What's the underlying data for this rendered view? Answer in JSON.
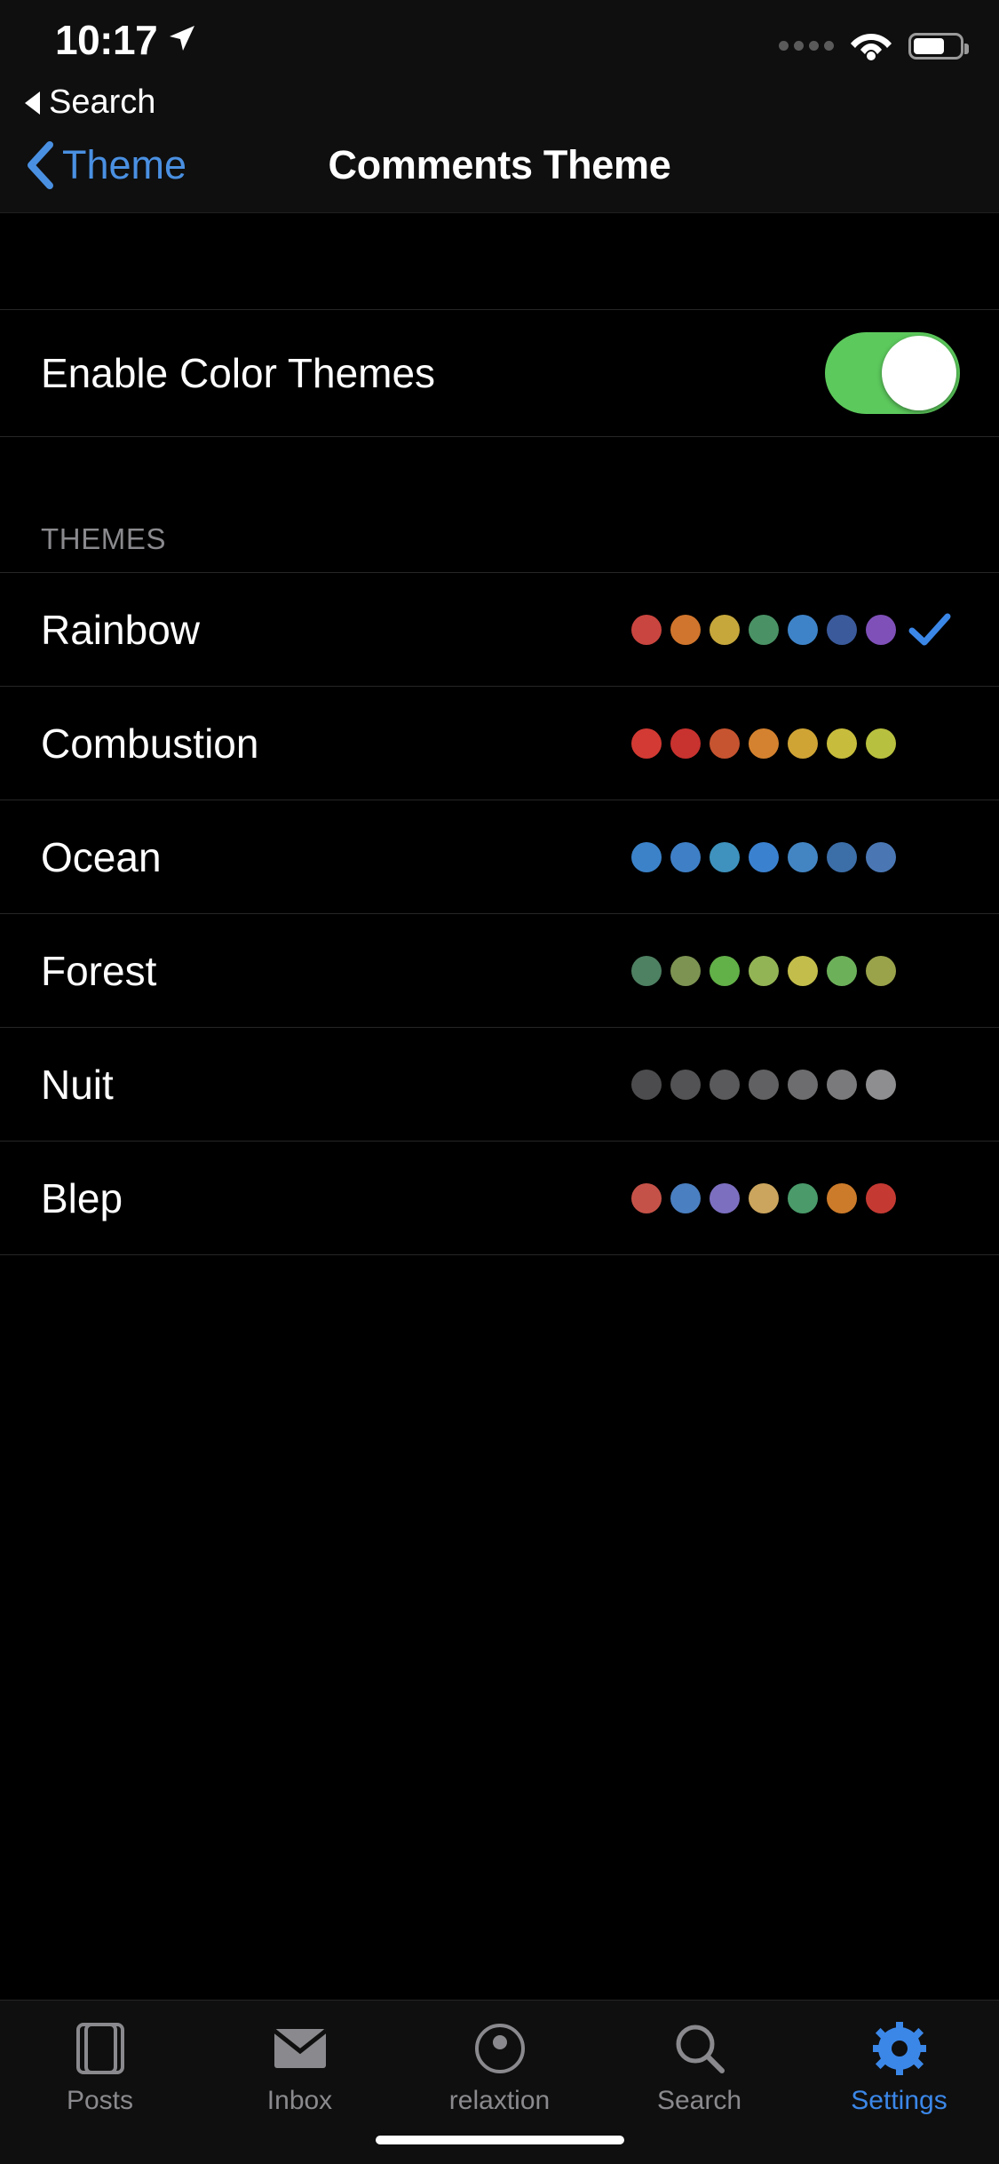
{
  "status_bar": {
    "time": "10:17",
    "location_icon": "location-arrow-icon",
    "cellular_icon": "cellular-dots-icon",
    "wifi_icon": "wifi-icon",
    "battery_icon": "battery-icon",
    "return_label": "Search",
    "return_icon": "triangle-left-icon"
  },
  "nav": {
    "back_label": "Theme",
    "back_icon": "chevron-left-icon",
    "title": "Comments Theme"
  },
  "toggle_row": {
    "label": "Enable Color Themes",
    "state": "on",
    "on_color": "#5cc95c",
    "knob_color": "#ffffff"
  },
  "themes_section": {
    "header": "THEMES",
    "selected": "Rainbow",
    "check_icon": "checkmark-icon",
    "check_color": "#3b87e8",
    "items": [
      {
        "name": "Rainbow",
        "selected": true,
        "colors": [
          "#c9453f",
          "#d0752d",
          "#c6a73c",
          "#4a9265",
          "#3e83c8",
          "#3a5a9b",
          "#7f50b8"
        ]
      },
      {
        "name": "Combustion",
        "selected": false,
        "colors": [
          "#d23a33",
          "#c8322f",
          "#c65430",
          "#d4822f",
          "#cfa435",
          "#c7bc3c",
          "#b8c03f"
        ]
      },
      {
        "name": "Ocean",
        "selected": false,
        "colors": [
          "#3b82c9",
          "#3f7fc6",
          "#3e92bd",
          "#3a81d0",
          "#4385c2",
          "#3c6ea8",
          "#4a77b4"
        ]
      },
      {
        "name": "Forest",
        "selected": false,
        "colors": [
          "#4e8062",
          "#7d9352",
          "#62b048",
          "#93b455",
          "#c3bd4b",
          "#6cb05a",
          "#9aa24a"
        ]
      },
      {
        "name": "Nuit",
        "selected": false,
        "colors": [
          "#4c4c4e",
          "#535355",
          "#5a5a5c",
          "#616163",
          "#6d6d6f",
          "#7a7a7c",
          "#8e8e90"
        ]
      },
      {
        "name": "Blep",
        "selected": false,
        "colors": [
          "#c55248",
          "#4a7fc1",
          "#7c6fc0",
          "#cba košile"
        ]
      }
    ]
  },
  "tabbar": {
    "active": "Settings",
    "items": [
      {
        "label": "Posts",
        "icon": "posts-icon",
        "active": false
      },
      {
        "label": "Inbox",
        "icon": "envelope-icon",
        "active": false
      },
      {
        "label": "relaxtion",
        "icon": "person-circle-icon",
        "active": false
      },
      {
        "label": "Search",
        "icon": "magnifier-icon",
        "active": false
      },
      {
        "label": "Settings",
        "icon": "gear-icon",
        "active": true
      }
    ]
  },
  "home_indicator": "home-indicator"
}
